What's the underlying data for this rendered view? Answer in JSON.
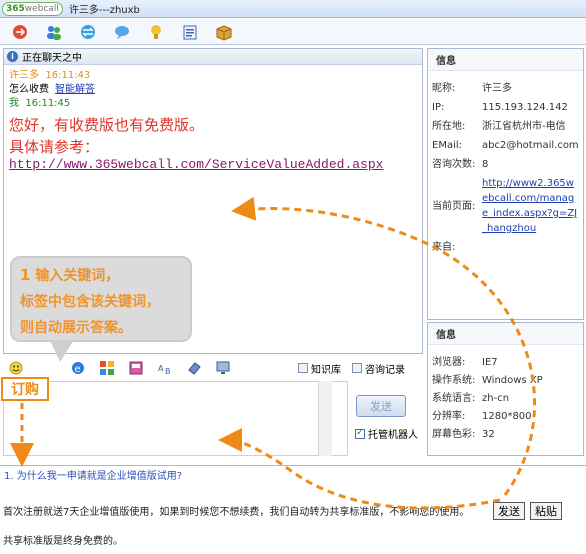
{
  "app": {
    "logo_text": "365webcall",
    "logo_part1": "365",
    "logo_part2": "webcall",
    "window_title": "许三多---zhuxb"
  },
  "toolbar": {
    "icons": [
      "transfer-icon",
      "people-icon",
      "swap-icon",
      "speech-icon",
      "lightbulb-icon",
      "clipboard-icon",
      "box-icon"
    ]
  },
  "chat": {
    "header_title": "正在聊天之中",
    "messages": [
      {
        "sender": "许三多",
        "time": "16:11:43",
        "text": "怎么收费",
        "link": "智能解答"
      },
      {
        "sender": "我",
        "time": "16:11:45",
        "lines": [
          "您好，有收费版也有免费版。",
          "具体请参考："
        ],
        "url": "http://www.365webcall.com/ServiceValueAdded.aspx"
      }
    ]
  },
  "callout": {
    "num": "1",
    "line1": "输入关键词，",
    "line2": "标签中包含该关键词，",
    "line3": "则自动展示答案。"
  },
  "input_toolbar": {
    "knowledge_label": "知识库",
    "history_label": "咨询记录"
  },
  "order_label": "订购",
  "composer": {
    "send_label": "发送",
    "robot_label": "托管机器人",
    "robot_checked": true
  },
  "visitor_info": {
    "title": "信息",
    "rows": [
      {
        "k": "昵称:",
        "v": "许三多"
      },
      {
        "k": "IP:",
        "v": "115.193.124.142"
      },
      {
        "k": "所在地:",
        "v": "浙江省杭州市-电信"
      },
      {
        "k": "EMail:",
        "v": "abc2@hotmail.com"
      },
      {
        "k": "咨询次数:",
        "v": "8"
      },
      {
        "k": "当前页面:",
        "v": "http://www2.365webcall.com/manage_index.aspx?g=ZJ_hangzhou",
        "link": true
      },
      {
        "k": "来自:",
        "v": ""
      }
    ]
  },
  "browser_info": {
    "title": "信息",
    "rows": [
      {
        "k": "浏览器:",
        "v": "IE7"
      },
      {
        "k": "操作系统:",
        "v": "Windows XP"
      },
      {
        "k": "系统语言:",
        "v": "zh-cn"
      },
      {
        "k": "分辨率:",
        "v": "1280*800"
      },
      {
        "k": "屏幕色彩:",
        "v": "32"
      }
    ]
  },
  "faq": {
    "question": "1. 为什么我一申请就是企业增值版试用?",
    "answer1": "首次注册就送7天企业增值版使用，如果到时候您不想续费，我们自动转为共享标准版，不影响您的使用。",
    "answer2": "共享标准版是终身免费的。",
    "send_label": "发送",
    "paste_label": "粘贴"
  },
  "colors": {
    "accent_orange": "#f08a16",
    "link_blue": "#1f3fb4",
    "chat_red": "#e0342a"
  }
}
